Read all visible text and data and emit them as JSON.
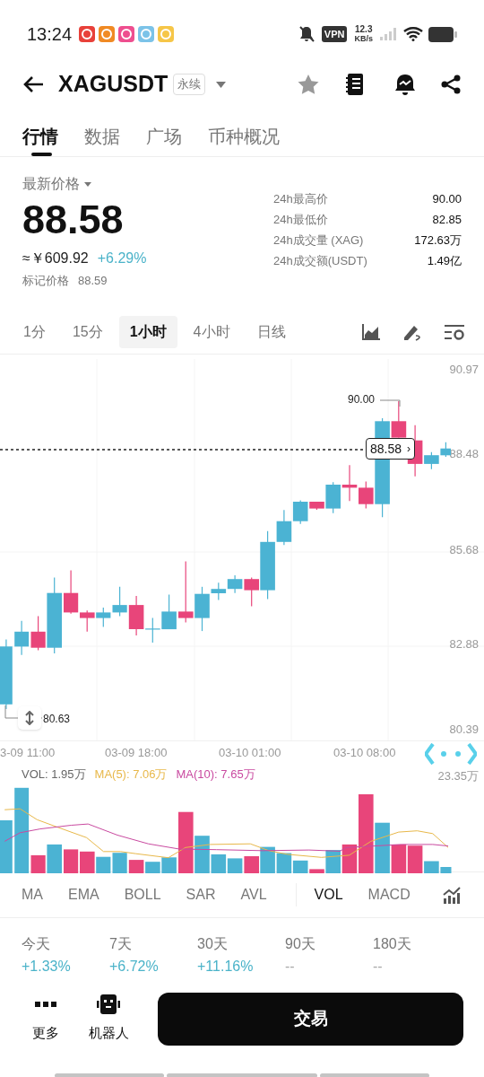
{
  "status_bar": {
    "time": "13:24",
    "vpn": "VPN",
    "speed": "12.3",
    "speed_unit": "KB/s"
  },
  "header": {
    "symbol": "XAGUSDT",
    "badge": "永续"
  },
  "tabs": [
    {
      "label": "行情",
      "selected": true
    },
    {
      "label": "数据",
      "selected": false
    },
    {
      "label": "广场",
      "selected": false
    },
    {
      "label": "币种概况",
      "selected": false
    }
  ],
  "price": {
    "label": "最新价格",
    "last": "88.58",
    "cny": "≈￥609.92",
    "change": "+6.29%",
    "mark_label": "标记价格",
    "mark": "88.59"
  },
  "stats": [
    {
      "label": "24h最高价",
      "value": "90.00"
    },
    {
      "label": "24h最低价",
      "value": "82.85"
    },
    {
      "label": "24h成交量 (XAG)",
      "value": "172.63万"
    },
    {
      "label": "24h成交额(USDT)",
      "value": "1.49亿"
    }
  ],
  "intervals": [
    {
      "label": "1分",
      "selected": false
    },
    {
      "label": "15分",
      "selected": false
    },
    {
      "label": "1小时",
      "selected": true
    },
    {
      "label": "4小时",
      "selected": false
    },
    {
      "label": "日线",
      "selected": false
    }
  ],
  "chart": {
    "y_labels": [
      "90.97",
      "88.48",
      "85.68",
      "82.88",
      "80.39"
    ],
    "high_marker": "90.00",
    "low_marker": "80.63",
    "current_price": "88.58",
    "price_tag_arrow": "›",
    "time_labels": [
      "3-09 11:00",
      "03-09 18:00",
      "03-10 01:00",
      "03-10 08:00"
    ]
  },
  "volume": {
    "legend": [
      {
        "text": "VOL: 1.95万",
        "color": "#666666"
      },
      {
        "text": "MA(5): 7.06万",
        "color": "#e8b84a"
      },
      {
        "text": "MA(10): 7.65万",
        "color": "#c94aa0"
      }
    ],
    "max_label": "23.35万"
  },
  "indicators": [
    {
      "label": "MA",
      "selected": false
    },
    {
      "label": "EMA",
      "selected": false
    },
    {
      "label": "BOLL",
      "selected": false
    },
    {
      "label": "SAR",
      "selected": false
    },
    {
      "label": "AVL",
      "selected": false
    },
    {
      "label": "VOL",
      "selected": true
    },
    {
      "label": "MACD",
      "selected": false
    }
  ],
  "returns": [
    {
      "period": "今天",
      "change": "+1.33%",
      "kind": "up"
    },
    {
      "period": "7天",
      "change": "+6.72%",
      "kind": "up"
    },
    {
      "period": "30天",
      "change": "+11.16%",
      "kind": "up"
    },
    {
      "period": "90天",
      "change": "--",
      "kind": "none"
    },
    {
      "period": "180天",
      "change": "--",
      "kind": "none"
    }
  ],
  "bottom": {
    "actions": [
      {
        "label": "更多",
        "kind": "more"
      },
      {
        "label": "机器人",
        "kind": "robot"
      }
    ],
    "trade_button": "交易"
  }
}
